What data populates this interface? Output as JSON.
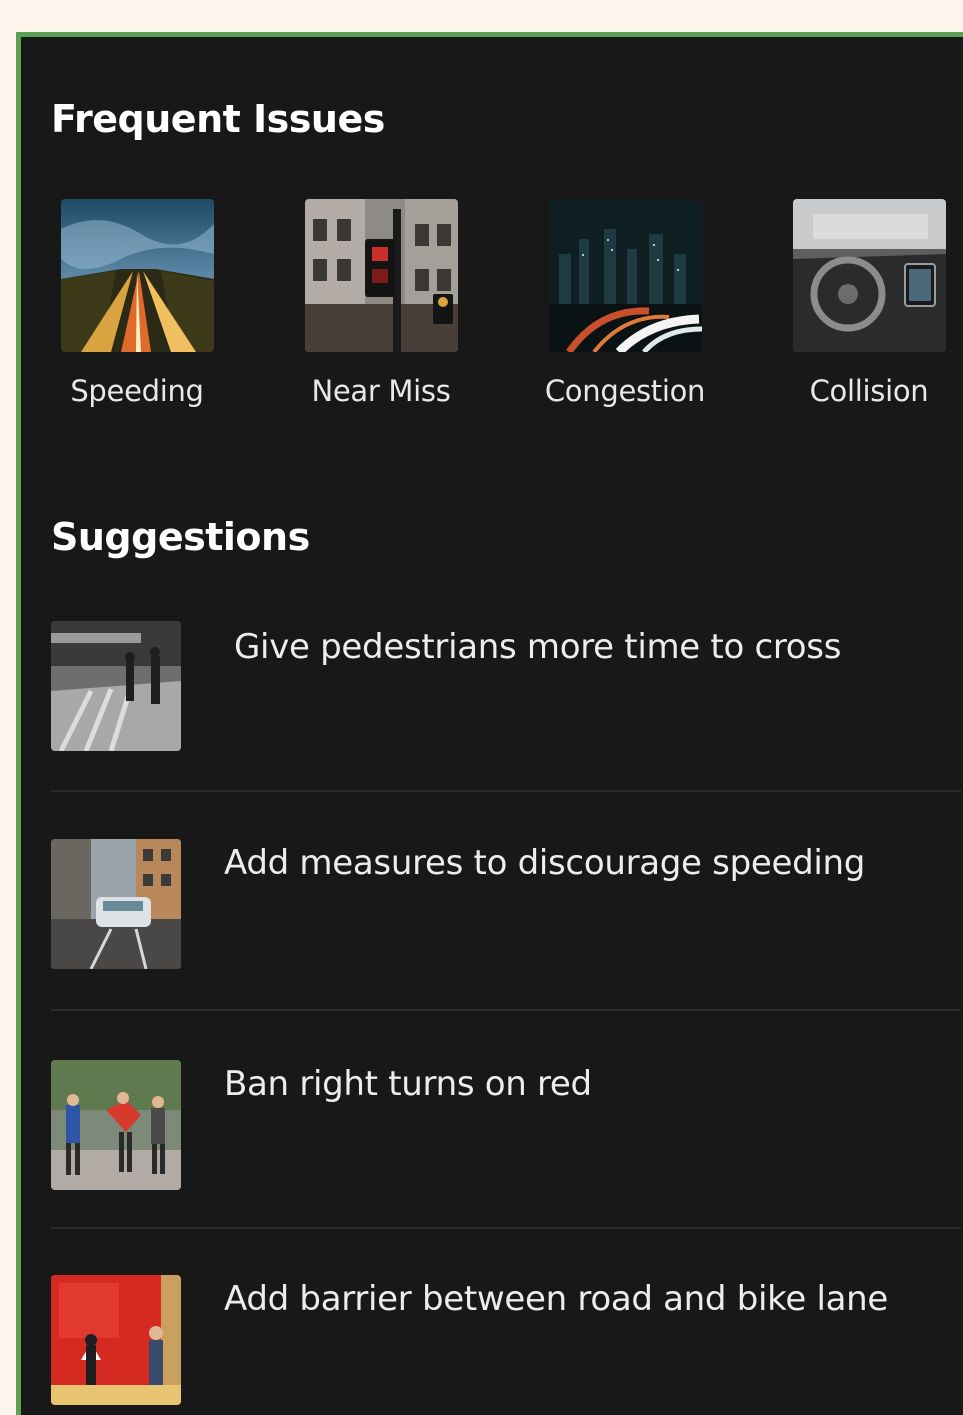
{
  "frequent_issues": {
    "title": "Frequent Issues",
    "items": [
      {
        "label": "Speeding",
        "image": "highway-light-trails-photo"
      },
      {
        "label": "Near Miss",
        "image": "traffic-signal-street-photo"
      },
      {
        "label": "Congestion",
        "image": "city-night-traffic-photo"
      },
      {
        "label": "Collision",
        "image": "car-dashboard-interior-photo"
      }
    ]
  },
  "suggestions": {
    "title": "Suggestions",
    "items": [
      {
        "text": "Give pedestrians more time to cross",
        "image": "crosswalk-pedestrians-bw-photo"
      },
      {
        "text": "Add measures to discourage speeding",
        "image": "street-car-photo"
      },
      {
        "text": "Ban right turns on red",
        "image": "people-walking-street-photo"
      },
      {
        "text": "Add barrier between road and bike lane",
        "image": "red-caution-sign-photo"
      }
    ]
  },
  "colors": {
    "panel_background": "#181818",
    "panel_border": "#5aa152",
    "page_background": "#fdf5ec",
    "text": "#ffffff"
  }
}
